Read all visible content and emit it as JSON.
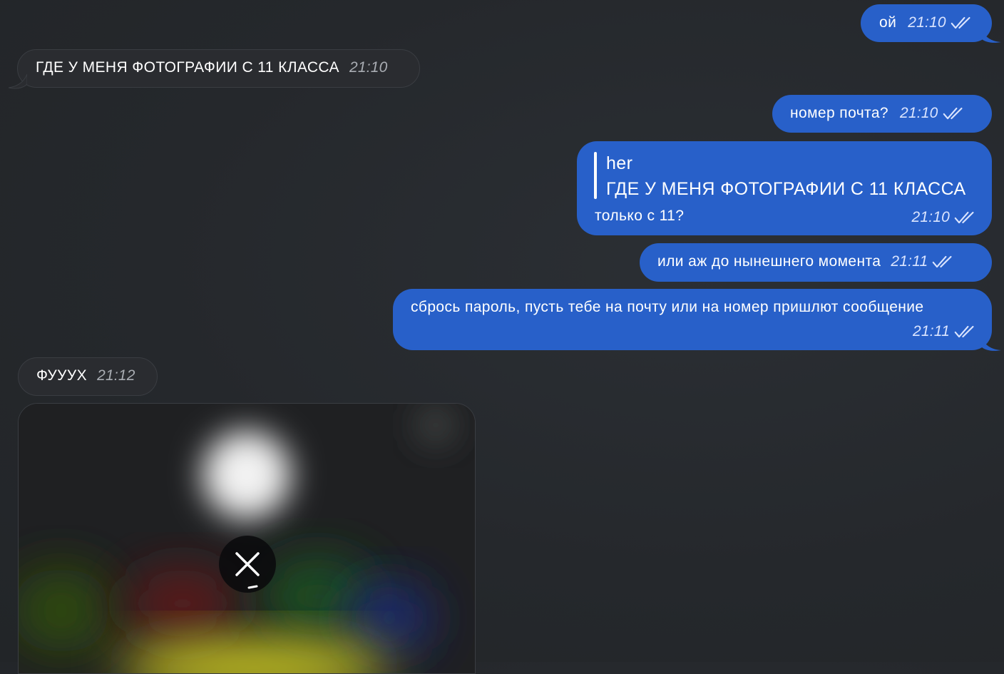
{
  "colors": {
    "outgoing": "#2860c9",
    "incoming": "#2a2c30",
    "background": "#25282c"
  },
  "messages": [
    {
      "text": "ой",
      "time": "21:10"
    },
    {
      "text": "ГДЕ У МЕНЯ ФОТОГРАФИИ С 11 КЛАССА",
      "time": "21:10"
    },
    {
      "text": "номер почта?",
      "time": "21:10"
    },
    {
      "reply_author": "her",
      "reply_text": "ГДЕ У МЕНЯ ФОТОГРАФИИ С 11 КЛАССА",
      "text": "только с 11?",
      "time": "21:10"
    },
    {
      "text": "или аж до нынешнего момента",
      "time": "21:11"
    },
    {
      "text": "сбрось пароль, пусть тебе на почту или на номер пришлют сообщение",
      "time": "21:11"
    },
    {
      "text": "ФУУУХ",
      "time": "21:12"
    }
  ],
  "media": {
    "cancel_icon": "close-icon",
    "status_icon": "read-checkmarks-icon"
  }
}
